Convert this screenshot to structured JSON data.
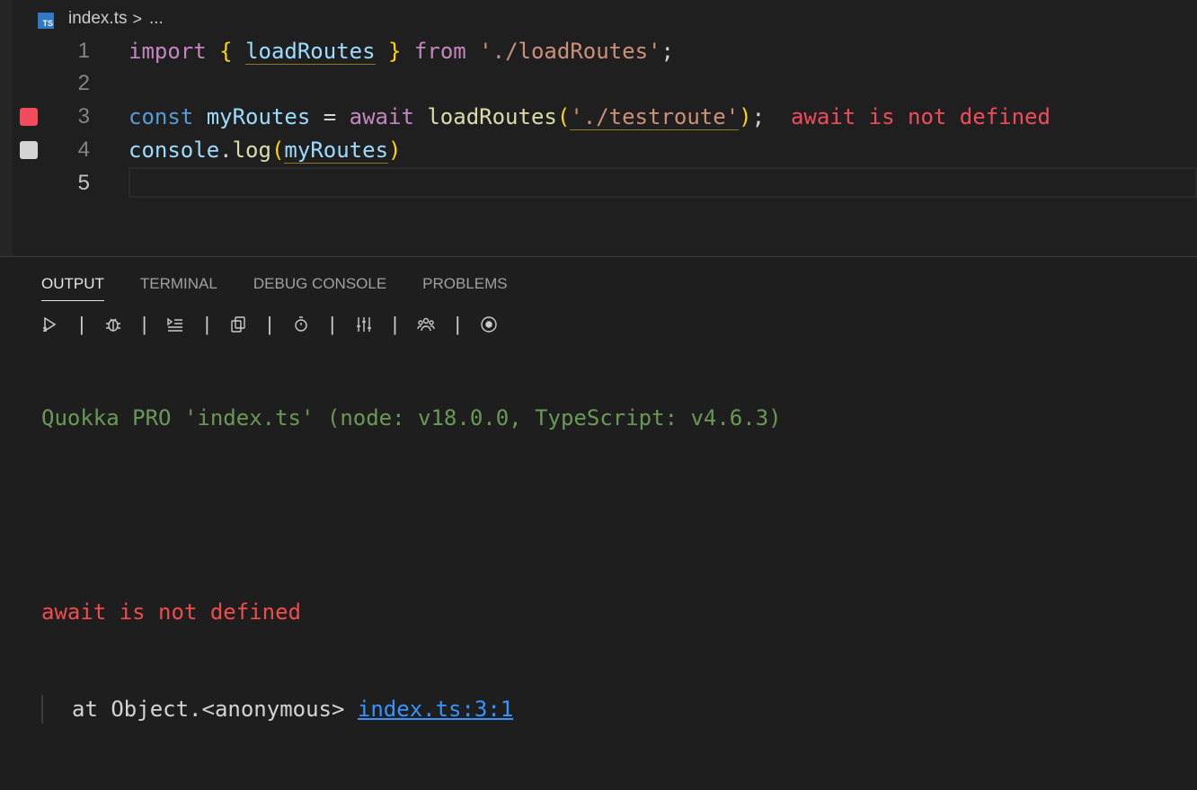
{
  "breadcrumb": {
    "file_icon": "TS",
    "file": "index.ts",
    "separator": ">",
    "more": "..."
  },
  "editor": {
    "lines": [
      {
        "num": "1"
      },
      {
        "num": "2"
      },
      {
        "num": "3"
      },
      {
        "num": "4"
      },
      {
        "num": "5"
      }
    ],
    "line1": {
      "import": "import",
      "lbrace": "{",
      "name": "loadRoutes",
      "rbrace": "}",
      "from": "from",
      "path": "'./loadRoutes'",
      "semi": ";"
    },
    "line3": {
      "const": "const",
      "var": "myRoutes",
      "eq": "=",
      "await": "await",
      "fn": "loadRoutes",
      "lparen": "(",
      "arg": "'./testroute'",
      "rparen": ")",
      "semi": ";",
      "error": "await is not defined"
    },
    "line4": {
      "obj": "console",
      "dot": ".",
      "method": "log",
      "lparen": "(",
      "arg": "myRoutes",
      "rparen": ")"
    },
    "gutter_colors": {
      "error": "#f14c5c",
      "covered": "#d4d4d4"
    }
  },
  "panel": {
    "tabs": [
      "OUTPUT",
      "TERMINAL",
      "DEBUG CONSOLE",
      "PROBLEMS"
    ],
    "toolbar_separator": "|",
    "output": {
      "header": "Quokka PRO 'index.ts' (node: v18.0.0, TypeScript: v4.6.3)",
      "error": "await is not defined",
      "stack_prefix": "at Object.<anonymous>",
      "stack_link": "index.ts:3:1"
    }
  }
}
